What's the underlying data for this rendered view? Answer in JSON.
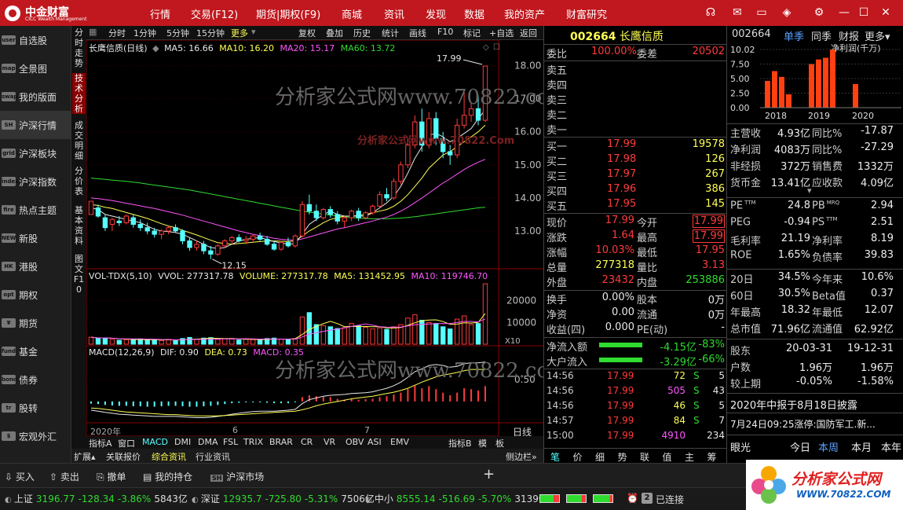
{
  "app": {
    "logo_text": "中金财富",
    "logo_sub": "CICC Wealth Management"
  },
  "menu": [
    "行情",
    "交易(F12)",
    "期货|期权(F9)",
    "商城",
    "资讯",
    "发现",
    "数据",
    "我的资产",
    "财富研究"
  ],
  "window_icons": [
    "headset-icon",
    "mail-icon",
    "shirt-icon",
    "cube-icon",
    "gear-icon",
    "minimize-icon",
    "maximize-icon",
    "close-icon"
  ],
  "leftnav": [
    {
      "label": "自选股",
      "icon": "user"
    },
    {
      "label": "全景图",
      "icon": "map"
    },
    {
      "label": "我的版面",
      "icon": "swap"
    },
    {
      "label": "沪深行情",
      "icon": "SH"
    },
    {
      "label": "沪深板块",
      "icon": "grid"
    },
    {
      "label": "沪深指数",
      "icon": "index"
    },
    {
      "label": "热点主题",
      "icon": "fire"
    },
    {
      "label": "新股",
      "icon": "NEW"
    },
    {
      "label": "港股",
      "icon": "HK"
    },
    {
      "label": "期权",
      "icon": "opt"
    },
    {
      "label": "期货",
      "icon": "¥"
    },
    {
      "label": "基金",
      "icon": "fund"
    },
    {
      "label": "债券",
      "icon": "bond"
    },
    {
      "label": "股转",
      "icon": "tr"
    },
    {
      "label": "宏观外汇",
      "icon": "$"
    }
  ],
  "vtabs": [
    "分时走势",
    "技术分析",
    "成交明细",
    "分价表",
    "基本资料",
    "图文F10"
  ],
  "toolbar": {
    "items": [
      "分时",
      "1分钟",
      "5分钟",
      "15分钟",
      "更多",
      "复权",
      "叠加",
      "历史",
      "统计",
      "画线",
      "F10",
      "标记",
      "+自选",
      "返回"
    ],
    "active": "更多"
  },
  "kline": {
    "title": "长鹰信质(日线)",
    "ma5": "MA5: 16.66",
    "ma10": "MA10: 16.20",
    "ma20": "MA20: 15.17",
    "ma60": "MA60: 13.72",
    "high_label": "17.99",
    "low_label": "12.15",
    "yticks": [
      "18.00",
      "17.00",
      "16.00",
      "15.00",
      "14.00",
      "13.00"
    ]
  },
  "vol": {
    "title": "VOL-TDX(5,10)",
    "vol": "VVOL: 277317.78",
    "volume": "VOLUME: 277317.78",
    "ma5": "MA5: 131452.95",
    "ma10": "MA10: 119746.70",
    "yticks": [
      "20000",
      "10000"
    ],
    "unit": "X10"
  },
  "macd": {
    "title": "MACD(12,26,9)",
    "dif": "DIF: 0.90",
    "dea": "DEA: 0.73",
    "macd": "MACD: 0.35",
    "yticks": [
      "0.50"
    ]
  },
  "xaxis": {
    "labels": [
      "2020年",
      "6",
      "7"
    ],
    "period": "日线"
  },
  "watermark": {
    "big": "分析家公式网www.70822.com",
    "small": "分析家公式网www.70822.Com"
  },
  "indtabs": {
    "items": [
      "指标A",
      "窗口",
      "MACD",
      "DMI",
      "DMA",
      "FSL",
      "TRIX",
      "BRAR",
      "CR",
      "VR",
      "OBV",
      "ASI",
      "EMV",
      "指标B",
      "模",
      "板"
    ],
    "active": "MACD"
  },
  "extratabs": {
    "items": [
      "扩展",
      "关联报价",
      "综合资讯",
      "行业资讯"
    ],
    "active": "综合资讯",
    "sidebar": "侧边栏"
  },
  "quote": {
    "code": "002664",
    "name": "长鹰信质",
    "weibi_label": "委比",
    "weibi": "100.00%",
    "weicha_label": "委差",
    "weicha": "20502",
    "asks": [
      "卖五",
      "卖四",
      "卖三",
      "卖二",
      "卖一"
    ],
    "bids": [
      {
        "label": "买一",
        "price": "17.99",
        "vol": "19578"
      },
      {
        "label": "买二",
        "price": "17.98",
        "vol": "126"
      },
      {
        "label": "买三",
        "price": "17.97",
        "vol": "267"
      },
      {
        "label": "买四",
        "price": "17.96",
        "vol": "386"
      },
      {
        "label": "买五",
        "price": "17.95",
        "vol": "145"
      }
    ],
    "stats": [
      {
        "l1": "现价",
        "v1": "17.99",
        "l2": "今开",
        "v2": "17.99"
      },
      {
        "l1": "涨跌",
        "v1": "1.64",
        "l2": "最高",
        "v2": "17.99"
      },
      {
        "l1": "涨幅",
        "v1": "10.03%",
        "l2": "最低",
        "v2": "17.95"
      },
      {
        "l1": "总量",
        "v1": "277318",
        "l2": "量比",
        "v2": "3.13"
      },
      {
        "l1": "外盘",
        "v1": "23432",
        "l2": "内盘",
        "v2": "253886"
      }
    ],
    "stats2": [
      {
        "l1": "换手",
        "v1": "0.00%",
        "l2": "股本",
        "v2": "0万"
      },
      {
        "l1": "净资",
        "v1": "0.00",
        "l2": "流通",
        "v2": "0万"
      },
      {
        "l1": "收益(四)",
        "v1": "0.000",
        "l2": "PE(动)",
        "v2": "-"
      }
    ],
    "flows": [
      {
        "label": "净流入额",
        "value": "-4.15亿",
        "pct": "-83%"
      },
      {
        "label": "大户流入",
        "value": "-3.29亿",
        "pct": "-66%"
      }
    ],
    "ticks": [
      {
        "t": "14:56",
        "p": "17.99",
        "v": "72",
        "s": "S",
        "n": "5"
      },
      {
        "t": "14:56",
        "p": "17.99",
        "v": "505",
        "s": "S",
        "n": "43"
      },
      {
        "t": "14:56",
        "p": "17.99",
        "v": "46",
        "s": "S",
        "n": "5"
      },
      {
        "t": "14:57",
        "p": "17.99",
        "v": "84",
        "s": "S",
        "n": "7"
      },
      {
        "t": "15:00",
        "p": "17.99",
        "v": "4910",
        "s": "",
        "n": "234"
      }
    ],
    "bottom_tabs": [
      "笔",
      "价",
      "细",
      "势",
      "联",
      "值",
      "主",
      "筹"
    ]
  },
  "fin": {
    "code": "002664",
    "tabs": [
      "单季",
      "同季",
      "财报",
      "更多"
    ],
    "chart_title": "净利润(千万)",
    "chart_yticks": [
      "10.02",
      "7.50",
      "5.00",
      "2.50",
      "0.00"
    ],
    "chart_years": [
      "2018",
      "2019",
      "2020"
    ],
    "rows1": [
      {
        "l1": "主营收",
        "v1": "4.93亿",
        "l2": "同比%",
        "v2": "-17.87"
      },
      {
        "l1": "净利润",
        "v1": "4083万",
        "l2": "同比%",
        "v2": "-27.29"
      },
      {
        "l1": "非经损",
        "v1": "372万",
        "l2": "销售费",
        "v2": "1332万"
      },
      {
        "l1": "货币金",
        "v1": "13.41亿",
        "l2": "应收款",
        "v2": "4.09亿"
      }
    ],
    "rows2": [
      {
        "l1": "PE",
        "s1": "TTM",
        "v1": "24.8",
        "l2": "PB",
        "s2": "MRQ",
        "v2": "2.94"
      },
      {
        "l1": "PEG",
        "s1": "",
        "v1": "-0.94",
        "l2": "PS",
        "s2": "TTM",
        "v2": "2.51"
      },
      {
        "l1": "毛利率",
        "s1": "",
        "v1": "21.19",
        "l2": "净利率",
        "s2": "",
        "v2": "8.19"
      },
      {
        "l1": "ROE",
        "s1": "",
        "v1": "1.65%",
        "l2": "负债率",
        "s2": "",
        "v2": "39.83"
      }
    ],
    "rows3": [
      {
        "l1": "20日",
        "v1": "34.5%",
        "l2": "今年来",
        "v2": "10.6%"
      },
      {
        "l1": "60日",
        "v1": "30.5%",
        "l2": "Beta值",
        "v2": "0.37"
      },
      {
        "l1": "年最高",
        "v1": "18.32",
        "l2": "年最低",
        "v2": "12.07"
      },
      {
        "l1": "总市值",
        "v1": "71.96亿",
        "l2": "流通值",
        "v2": "62.92亿"
      }
    ],
    "rows4": [
      {
        "l1": "股东",
        "v1": "20-03-31",
        "v2": "19-12-31"
      },
      {
        "l1": "户数",
        "v1": "1.96万",
        "v2": "1.96万"
      },
      {
        "l1": "较上期",
        "v1": "-0.05%",
        "v2": "-1.58%"
      }
    ],
    "notice1": "2020年中报于8月18日披露",
    "notice2": "7月24日09:25涨停:国防军工.新...",
    "bottom": [
      "眼光",
      "今日",
      "本周",
      "本月",
      "本年"
    ],
    "bottom_active": "本周"
  },
  "tradebar": [
    "买入",
    "卖出",
    "撤单",
    "我的持仓",
    "沪深市场"
  ],
  "statusbar": {
    "items": [
      {
        "name": "上证",
        "value": "3196.77",
        "chg": "-128.34",
        "pct": "-3.86%",
        "amt": "5843亿"
      },
      {
        "name": "深证",
        "value": "12935.7",
        "chg": "-725.80",
        "pct": "-5.31%",
        "amt": "7506亿"
      },
      {
        "name": "中小",
        "value": "8555.14",
        "chg": "-516.69",
        "pct": "-5.70%",
        "amt": "3139亿"
      }
    ],
    "conn": "已连接",
    "conn_count": "2"
  },
  "brand": {
    "title": "分析家公式网",
    "url": "WWW.70822.COM"
  },
  "chart_data": {
    "type": "candlestick",
    "candles": [
      [
        13.5,
        13.9,
        13.5,
        13.9
      ],
      [
        13.7,
        13.8,
        13.4,
        13.45
      ],
      [
        13.4,
        13.5,
        13.0,
        13.1
      ],
      [
        13.2,
        13.4,
        13.0,
        13.35
      ],
      [
        13.3,
        13.45,
        13.15,
        13.25
      ],
      [
        13.25,
        13.5,
        13.2,
        13.45
      ],
      [
        13.4,
        13.5,
        13.1,
        13.2
      ],
      [
        13.2,
        13.35,
        13.0,
        13.1
      ],
      [
        13.1,
        13.25,
        12.9,
        13.0
      ],
      [
        13.0,
        13.1,
        12.8,
        12.9
      ],
      [
        12.9,
        13.05,
        12.75,
        13.0
      ],
      [
        13.0,
        13.15,
        12.9,
        13.1
      ],
      [
        13.1,
        13.2,
        12.95,
        13.0
      ],
      [
        13.0,
        13.05,
        12.6,
        12.7
      ],
      [
        12.7,
        12.8,
        12.4,
        12.5
      ],
      [
        12.5,
        12.7,
        12.4,
        12.6
      ],
      [
        12.6,
        12.7,
        12.3,
        12.4
      ],
      [
        12.4,
        12.55,
        12.15,
        12.3
      ],
      [
        12.3,
        12.6,
        12.25,
        12.55
      ],
      [
        12.55,
        12.75,
        12.5,
        12.7
      ],
      [
        12.7,
        12.85,
        12.6,
        12.8
      ],
      [
        12.8,
        12.9,
        12.65,
        12.7
      ],
      [
        12.7,
        12.85,
        12.6,
        12.75
      ],
      [
        12.75,
        12.9,
        12.65,
        12.85
      ],
      [
        12.85,
        12.95,
        12.7,
        12.75
      ],
      [
        12.75,
        12.85,
        12.55,
        12.6
      ],
      [
        12.6,
        12.7,
        12.4,
        12.45
      ],
      [
        12.45,
        12.7,
        12.4,
        12.65
      ],
      [
        12.65,
        12.8,
        12.5,
        12.55
      ],
      [
        12.55,
        12.9,
        12.5,
        12.85
      ],
      [
        12.85,
        13.9,
        12.8,
        13.8
      ],
      [
        13.8,
        14.1,
        13.5,
        13.6
      ],
      [
        13.6,
        13.8,
        13.3,
        13.4
      ],
      [
        13.4,
        13.7,
        13.35,
        13.65
      ],
      [
        13.65,
        13.75,
        13.4,
        13.5
      ],
      [
        13.5,
        13.6,
        13.2,
        13.3
      ],
      [
        13.3,
        13.45,
        13.1,
        13.4
      ],
      [
        13.4,
        13.65,
        13.3,
        13.6
      ],
      [
        13.6,
        13.7,
        13.3,
        13.4
      ],
      [
        13.4,
        13.6,
        13.35,
        13.55
      ],
      [
        13.55,
        13.8,
        13.5,
        13.75
      ],
      [
        13.75,
        14.2,
        13.7,
        14.1
      ],
      [
        14.1,
        14.3,
        13.9,
        14.0
      ],
      [
        14.0,
        14.6,
        13.95,
        14.5
      ],
      [
        14.5,
        15.1,
        14.4,
        15.0
      ],
      [
        15.0,
        15.8,
        14.9,
        15.6
      ],
      [
        15.6,
        16.5,
        15.5,
        16.3
      ],
      [
        16.3,
        16.7,
        15.4,
        15.6
      ],
      [
        15.6,
        16.6,
        15.5,
        16.4
      ],
      [
        16.4,
        16.6,
        15.6,
        15.8
      ],
      [
        15.8,
        16.0,
        15.2,
        15.4
      ],
      [
        15.4,
        15.6,
        15.0,
        15.3
      ],
      [
        15.3,
        16.4,
        15.2,
        16.2
      ],
      [
        16.2,
        17.2,
        16.1,
        16.5
      ],
      [
        16.5,
        16.9,
        16.3,
        16.7
      ],
      [
        16.7,
        17.1,
        16.2,
        16.35
      ],
      [
        16.35,
        17.99,
        16.3,
        17.99
      ]
    ],
    "ma5": [
      13.7,
      13.65,
      13.5,
      13.45,
      13.4,
      13.35,
      13.3,
      13.25,
      13.15,
      13.05,
      13.0,
      12.98,
      12.95,
      12.9,
      12.8,
      12.7,
      12.6,
      12.5,
      12.47,
      12.5,
      12.6,
      12.7,
      12.75,
      12.78,
      12.8,
      12.74,
      12.68,
      12.64,
      12.6,
      12.62,
      12.9,
      13.2,
      13.35,
      13.5,
      13.6,
      13.5,
      13.45,
      13.45,
      13.45,
      13.45,
      13.55,
      13.7,
      13.85,
      14.05,
      14.35,
      14.75,
      15.2,
      15.55,
      15.9,
      15.95,
      15.85,
      15.7,
      15.8,
      15.95,
      16.1,
      16.4,
      16.66
    ],
    "ma10": [
      13.8,
      13.77,
      13.72,
      13.68,
      13.62,
      13.56,
      13.5,
      13.44,
      13.38,
      13.3,
      13.22,
      13.15,
      13.1,
      13.02,
      12.95,
      12.88,
      12.8,
      12.72,
      12.65,
      12.62,
      12.6,
      12.62,
      12.64,
      12.66,
      12.68,
      12.7,
      12.7,
      12.69,
      12.68,
      12.7,
      12.85,
      13.0,
      13.12,
      13.25,
      13.35,
      13.4,
      13.45,
      13.45,
      13.47,
      13.5,
      13.55,
      13.6,
      13.65,
      13.75,
      13.9,
      14.1,
      14.35,
      14.6,
      14.9,
      15.1,
      15.3,
      15.4,
      15.55,
      15.7,
      15.85,
      16.0,
      16.2
    ],
    "ma20": [
      14.0,
      13.98,
      13.95,
      13.92,
      13.88,
      13.84,
      13.8,
      13.76,
      13.72,
      13.68,
      13.63,
      13.58,
      13.53,
      13.48,
      13.42,
      13.36,
      13.3,
      13.24,
      13.18,
      13.12,
      13.06,
      13.0,
      12.95,
      12.9,
      12.86,
      12.82,
      12.78,
      12.75,
      12.73,
      12.72,
      12.76,
      12.82,
      12.88,
      12.94,
      13.0,
      13.06,
      13.1,
      13.15,
      13.2,
      13.25,
      13.3,
      13.36,
      13.42,
      13.5,
      13.6,
      13.72,
      13.86,
      14.0,
      14.15,
      14.3,
      14.45,
      14.58,
      14.72,
      14.86,
      14.98,
      15.08,
      15.17
    ],
    "ma60": [
      14.6,
      14.58,
      14.56,
      14.54,
      14.52,
      14.5,
      14.48,
      14.45,
      14.42,
      14.39,
      14.36,
      14.33,
      14.3,
      14.27,
      14.24,
      14.2,
      14.16,
      14.12,
      14.08,
      14.04,
      14.0,
      13.96,
      13.92,
      13.88,
      13.84,
      13.8,
      13.76,
      13.72,
      13.68,
      13.64,
      13.6,
      13.57,
      13.54,
      13.51,
      13.48,
      13.45,
      13.43,
      13.41,
      13.39,
      13.38,
      13.37,
      13.37,
      13.37,
      13.38,
      13.39,
      13.41,
      13.43,
      13.46,
      13.49,
      13.52,
      13.55,
      13.58,
      13.61,
      13.64,
      13.67,
      13.7,
      13.72
    ],
    "volume": [
      3200,
      2600,
      2900,
      2200,
      1800,
      2100,
      2000,
      2400,
      1900,
      2100,
      1700,
      2200,
      1600,
      2600,
      3100,
      2300,
      2800,
      3000,
      2200,
      2500,
      2400,
      1900,
      2300,
      2100,
      2000,
      2600,
      2800,
      2300,
      2100,
      2600,
      12500,
      14500,
      9000,
      8500,
      8000,
      7200,
      7600,
      9500,
      8400,
      7800,
      7000,
      7500,
      6800,
      8000,
      9000,
      12000,
      13500,
      11000,
      10000,
      9500,
      8000,
      7000,
      11500,
      13000,
      9000,
      9500,
      27731
    ],
    "macd": [
      -0.05,
      -0.06,
      -0.08,
      -0.09,
      -0.1,
      -0.1,
      -0.11,
      -0.11,
      -0.12,
      -0.12,
      -0.11,
      -0.1,
      -0.1,
      -0.11,
      -0.12,
      -0.12,
      -0.11,
      -0.1,
      -0.08,
      -0.06,
      -0.04,
      -0.03,
      -0.02,
      -0.02,
      -0.02,
      -0.03,
      -0.04,
      -0.04,
      -0.04,
      -0.02,
      0.1,
      0.14,
      0.12,
      0.11,
      0.1,
      0.06,
      0.04,
      0.05,
      0.04,
      0.05,
      0.06,
      0.1,
      0.12,
      0.16,
      0.2,
      0.28,
      0.36,
      0.3,
      0.35,
      0.28,
      0.2,
      0.14,
      0.2,
      0.3,
      0.28,
      0.25,
      0.35
    ],
    "dif": [
      -0.2,
      -0.22,
      -0.25,
      -0.27,
      -0.29,
      -0.3,
      -0.31,
      -0.32,
      -0.33,
      -0.34,
      -0.34,
      -0.34,
      -0.34,
      -0.35,
      -0.36,
      -0.37,
      -0.37,
      -0.36,
      -0.34,
      -0.32,
      -0.29,
      -0.27,
      -0.25,
      -0.23,
      -0.22,
      -0.22,
      -0.22,
      -0.21,
      -0.2,
      -0.18,
      -0.05,
      0.04,
      0.08,
      0.12,
      0.14,
      0.15,
      0.16,
      0.18,
      0.19,
      0.2,
      0.22,
      0.26,
      0.3,
      0.36,
      0.44,
      0.55,
      0.68,
      0.74,
      0.82,
      0.84,
      0.82,
      0.78,
      0.8,
      0.86,
      0.88,
      0.88,
      0.9
    ],
    "dea": [
      -0.15,
      -0.16,
      -0.18,
      -0.2,
      -0.22,
      -0.24,
      -0.25,
      -0.26,
      -0.27,
      -0.28,
      -0.29,
      -0.3,
      -0.3,
      -0.31,
      -0.32,
      -0.33,
      -0.33,
      -0.33,
      -0.33,
      -0.32,
      -0.31,
      -0.3,
      -0.29,
      -0.28,
      -0.27,
      -0.26,
      -0.25,
      -0.24,
      -0.23,
      -0.22,
      -0.19,
      -0.15,
      -0.1,
      -0.06,
      -0.03,
      0.0,
      0.03,
      0.06,
      0.08,
      0.1,
      0.12,
      0.15,
      0.18,
      0.21,
      0.25,
      0.3,
      0.37,
      0.44,
      0.5,
      0.56,
      0.6,
      0.63,
      0.66,
      0.7,
      0.73,
      0.73,
      0.73
    ],
    "fin_bars": [
      4.6,
      6.3,
      5.3,
      2.3,
      7.5,
      8.3,
      8.6,
      10.0,
      4.08
    ]
  }
}
